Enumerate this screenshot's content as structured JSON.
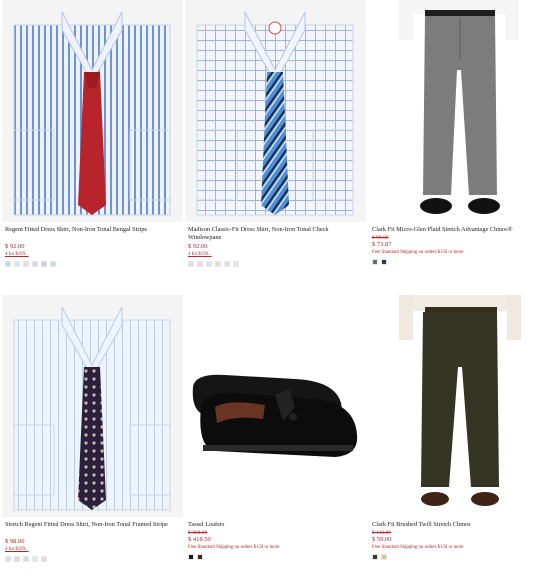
{
  "products": [
    {
      "name": "Regent Fitted Dress Shirt, Non-Iron Tonal Bengal Stripe",
      "price": "$ 92.00",
      "promo": "4 for $199...",
      "swatches": [
        "#c8d6ea",
        "#d9e3f2",
        "#f1d6dc",
        "#cdd7e8",
        "#bfcfe6",
        "#c6dcea"
      ],
      "image_icon": "striped-dress-shirt-with-red-tie"
    },
    {
      "name": "Madison Classic-Fit Dress Shirt, Non-Iron Tonal Check Windowpane",
      "price": "$ 92.00",
      "promo": "4 for $199...",
      "swatches": [
        "#d7e0ee",
        "#f0d8de",
        "#d6e3ef",
        "#e9dccb",
        "#ecd9e0",
        "#f2e5cf"
      ],
      "image_icon": "check-dress-shirt-with-blue-striped-tie"
    },
    {
      "name": "Clark Fit Micro-Glen Plaid Stretch Advantage Chinos®",
      "price_original": "$ 98.00",
      "price_sale": "$ 73.87",
      "promo": "Free Standard Shipping on orders $150 or more",
      "swatches": [
        "#6d6d6d",
        "#2f3a55"
      ],
      "image_icon": "grey-chino-pants-on-model"
    },
    {
      "name": "Stretch Regent Fitted Dress Shirt, Non-Iron Tonal Framed Stripe",
      "price": "$ 98.00",
      "promo": "4 for $199...",
      "swatches": [
        "#d4deea",
        "#e9d3da",
        "#d0dced",
        "#e6e6e6",
        "#ecd5dc"
      ],
      "image_icon": "light-blue-dress-shirt-with-paisley-tie"
    },
    {
      "name": "Tassel Loafers",
      "price_original": "$ 368.00",
      "price_sale": "$ 418.50",
      "promo": "Free Standard Shipping on orders $150 or more",
      "swatches": [
        "#1b1b1b",
        "#4a1e1e"
      ],
      "image_icon": "black-tassel-loafers"
    },
    {
      "name": "Clark Fit Brushed Twill Stretch Chinos",
      "price_original": "$ 118.00",
      "price_sale": "$ 59.00",
      "promo": "Free Standard Shipping on orders $150 or more",
      "swatches": [
        "#3a3a2a",
        "#d9c3a0"
      ],
      "image_icon": "dark-olive-chino-pants-on-model"
    }
  ],
  "colors": {
    "price": "#b3282d",
    "text": "#222222"
  }
}
